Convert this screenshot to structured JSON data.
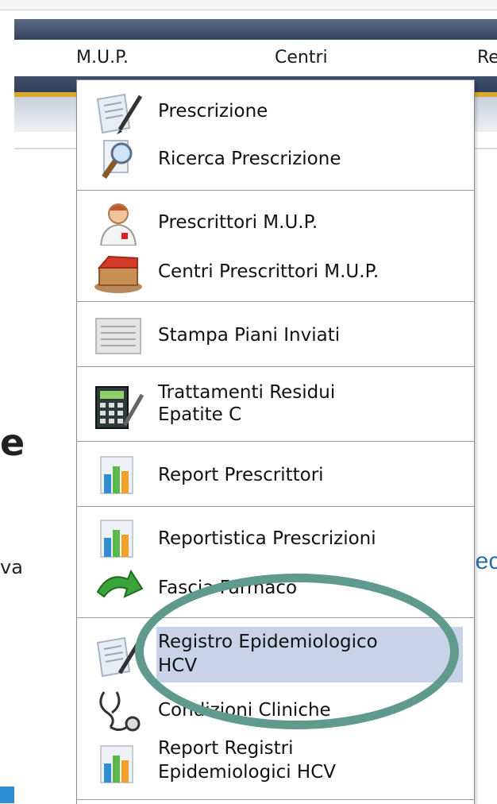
{
  "menubar": {
    "items": [
      {
        "label": "M.U.P."
      },
      {
        "label": "Centri"
      },
      {
        "label": "Re"
      }
    ]
  },
  "background": {
    "fragment_e": "e",
    "fragment_va": "va",
    "fragment_recl": "Recl"
  },
  "dropdown": {
    "groups": [
      {
        "items": [
          {
            "label": "Prescrizione",
            "icon": "prescription-document-icon"
          },
          {
            "label": "Ricerca Prescrizione",
            "icon": "magnifier-search-icon"
          }
        ]
      },
      {
        "items": [
          {
            "label": "Prescrittori M.U.P.",
            "icon": "doctor-icon"
          },
          {
            "label": "Centri Prescrittori M.U.P.",
            "icon": "building-icon"
          }
        ]
      },
      {
        "items": [
          {
            "label": "Stampa Piani Inviati",
            "icon": "printed-pages-icon"
          }
        ]
      },
      {
        "items": [
          {
            "label_line1": "Trattamenti Residui",
            "label_line2": "Epatite C",
            "icon": "calculator-pen-icon"
          }
        ]
      },
      {
        "items": [
          {
            "label": "Report Prescrittori",
            "icon": "bar-chart-icon"
          }
        ]
      },
      {
        "items": [
          {
            "label": "Reportistica Prescrizioni",
            "icon": "bar-chart-icon"
          },
          {
            "label": "Fascia Farmaco",
            "icon": "green-arrow-icon"
          }
        ]
      },
      {
        "items": [
          {
            "label_line1": "Registro Epidemiologico",
            "label_line2": "HCV",
            "icon": "prescription-document-icon",
            "highlighted": true
          },
          {
            "label": "Condizioni Cliniche",
            "icon": "stethoscope-icon"
          },
          {
            "label_line1": "Report Registri",
            "label_line2": "Epidemiologici HCV",
            "icon": "bar-chart-icon"
          }
        ]
      }
    ]
  },
  "annotation": {
    "color": "#5f9a8c"
  },
  "colors": {
    "highlight": "#c8d3ea",
    "header_dark": "#34425c",
    "header_gold": "#d9a92b",
    "link_blue": "#2e6da4"
  }
}
